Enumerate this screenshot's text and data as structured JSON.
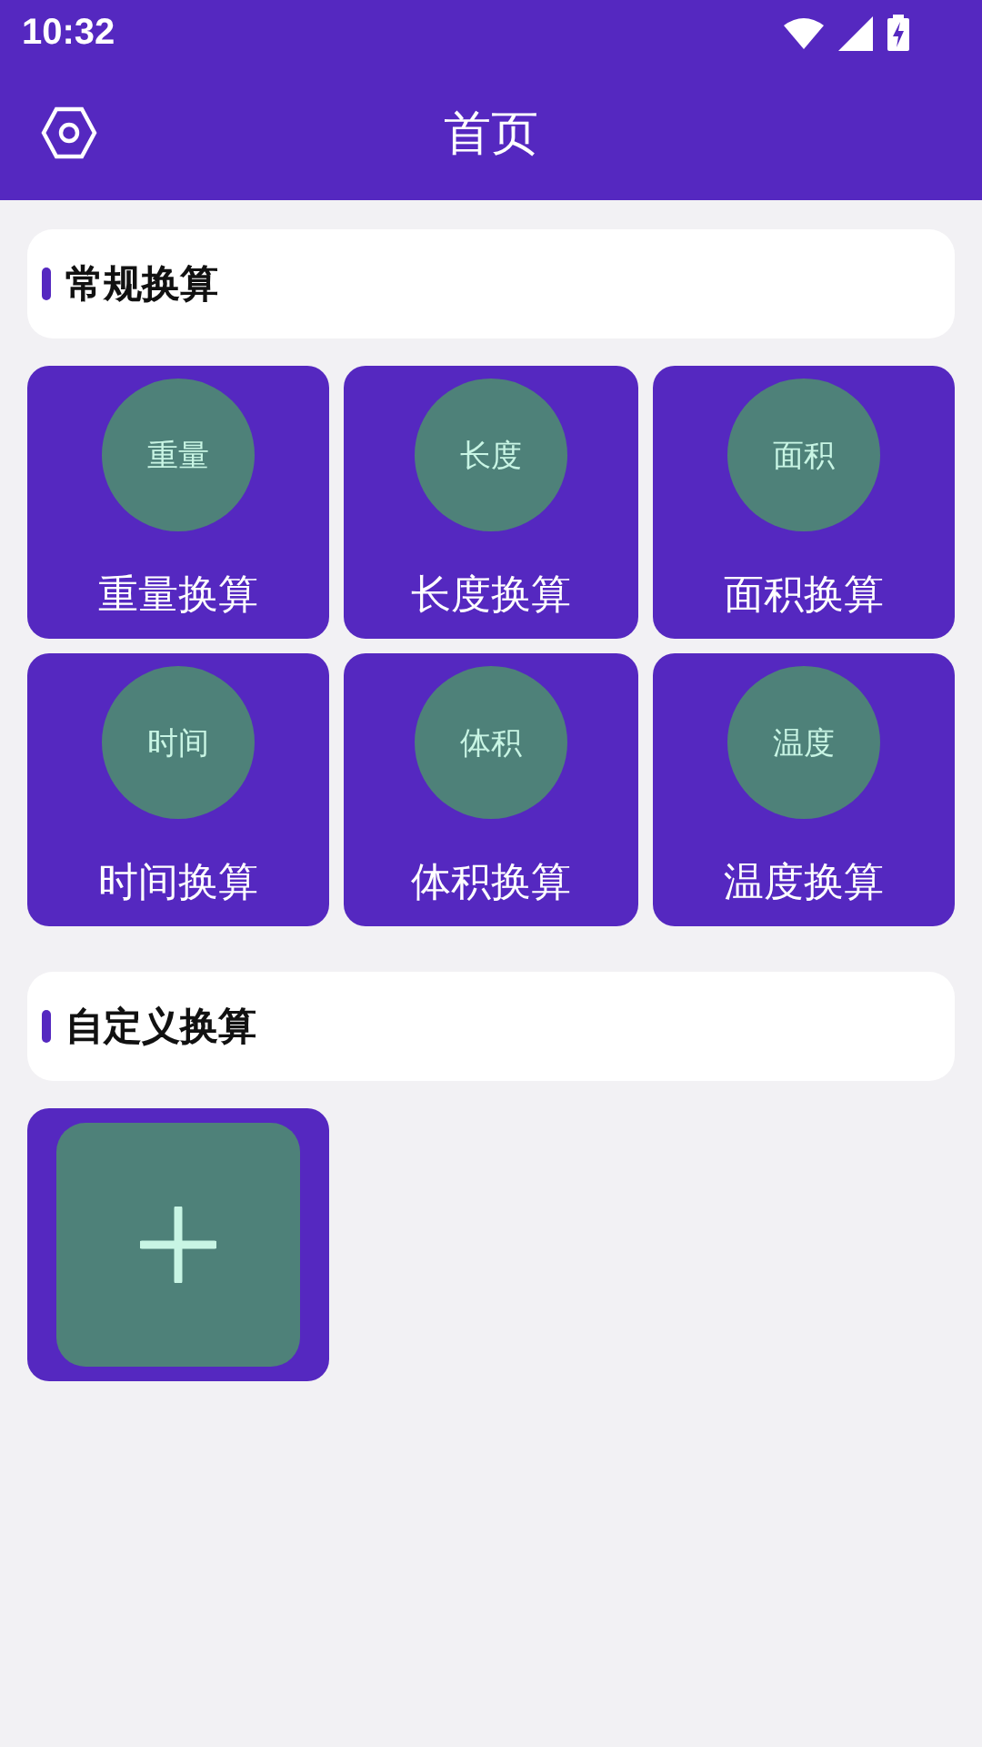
{
  "status_bar": {
    "time": "10:32"
  },
  "app_bar": {
    "title": "首页"
  },
  "sections": [
    {
      "title": "常规换算",
      "tiles": [
        {
          "badge": "重量",
          "label": "重量换算"
        },
        {
          "badge": "长度",
          "label": "长度换算"
        },
        {
          "badge": "面积",
          "label": "面积换算"
        },
        {
          "badge": "时间",
          "label": "时间换算"
        },
        {
          "badge": "体积",
          "label": "体积换算"
        },
        {
          "badge": "温度",
          "label": "温度换算"
        }
      ]
    },
    {
      "title": "自定义换算",
      "tiles": [
        {
          "kind": "add"
        }
      ]
    }
  ]
}
